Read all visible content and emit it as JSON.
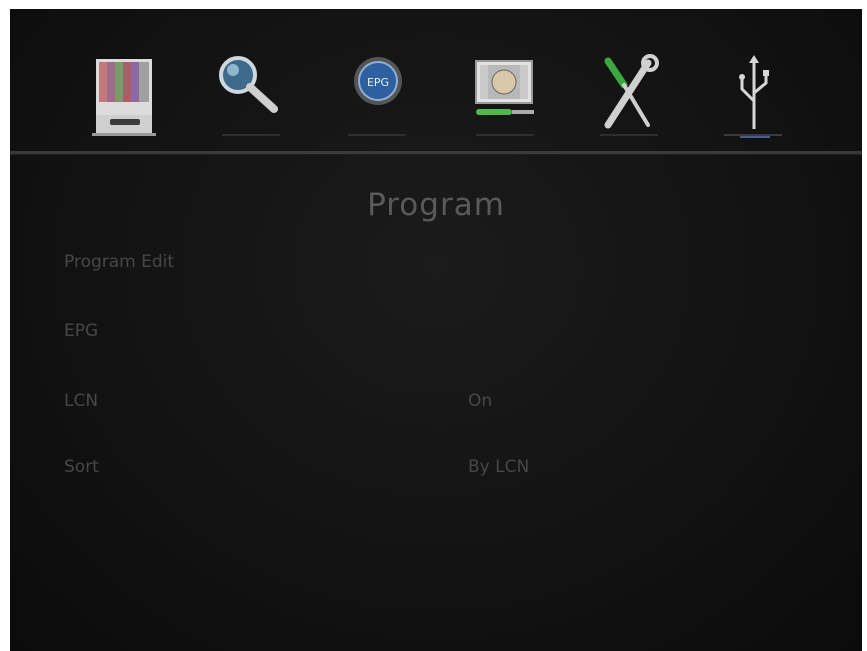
{
  "top_menu": {
    "items": [
      {
        "name": "program-menu",
        "icon": "tv-icon"
      },
      {
        "name": "search-menu",
        "icon": "magnifier-icon"
      },
      {
        "name": "epg-menu",
        "icon": "epg-globe-icon",
        "badge_text": "EPG"
      },
      {
        "name": "picture-menu",
        "icon": "picture-test-icon"
      },
      {
        "name": "tools-menu",
        "icon": "tools-icon"
      },
      {
        "name": "usb-menu",
        "icon": "usb-icon"
      }
    ]
  },
  "page": {
    "title": "Program"
  },
  "menu": {
    "rows": [
      {
        "label": "Program Edit",
        "value": ""
      },
      {
        "label": "EPG",
        "value": ""
      },
      {
        "label": "LCN",
        "value": "On"
      },
      {
        "label": "Sort",
        "value": "By LCN"
      }
    ]
  },
  "colors": {
    "background": "#141414",
    "text": "#474747",
    "title": "#5a5a5a",
    "divider": "#3a3a3a"
  }
}
